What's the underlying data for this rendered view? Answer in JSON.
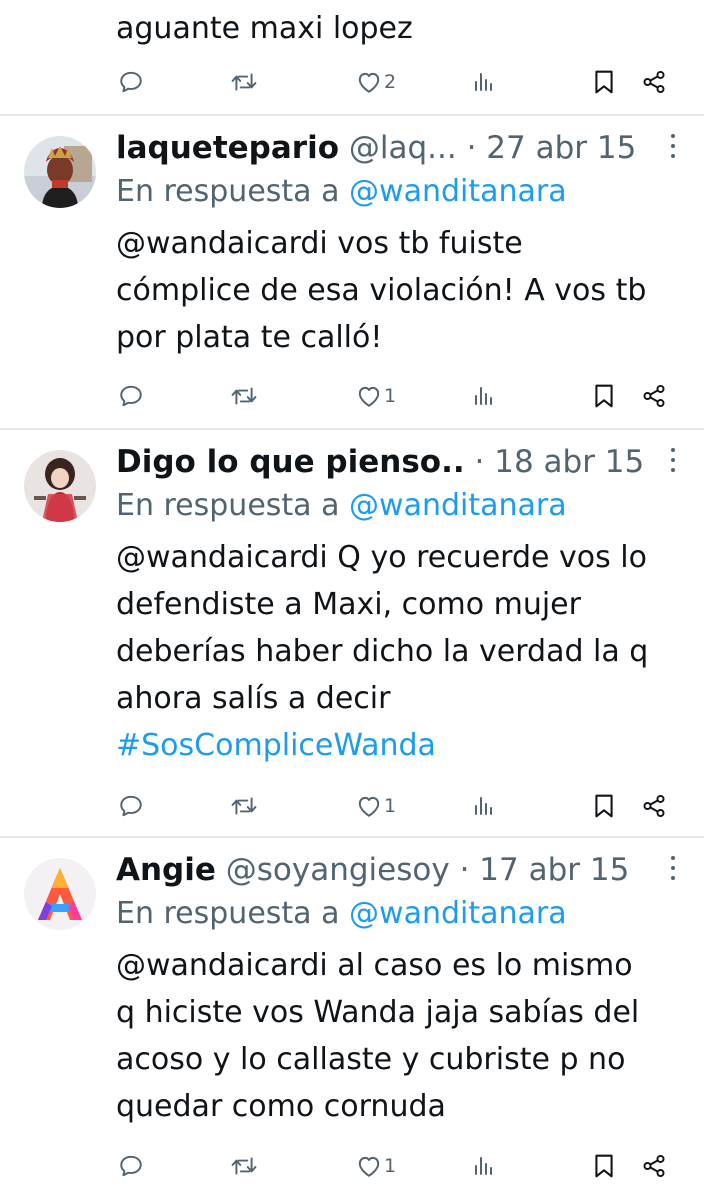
{
  "tweets": [
    {
      "body_lines": [
        "aguante maxi lopez"
      ],
      "actions": {
        "likes": "2"
      }
    },
    {
      "name": "laquetepario",
      "handle": "@laq...",
      "time": "· 27 abr 15",
      "reply_prefix": "En respuesta a",
      "reply_to": "@wanditanara",
      "body_lines": [
        "@wandaicardi vos tb fuiste",
        "cómplice de esa violación! A vos tb",
        "por plata te calló!"
      ],
      "actions": {
        "likes": "1"
      }
    },
    {
      "name": "Digo lo que pienso..",
      "time": "· 18 abr 15",
      "reply_prefix": "En respuesta a",
      "reply_to": "@wanditanara",
      "body_lines": [
        "@wandaicardi Q yo recuerde vos lo",
        "defendiste a Maxi, como mujer",
        "deberías haber dicho la verdad la q",
        "ahora salís a decir"
      ],
      "hashtag": "#SosCompliceWanda",
      "actions": {
        "likes": "1"
      }
    },
    {
      "name": "Angie",
      "handle": "@soyangiesoy",
      "time": "· 17 abr 15",
      "reply_prefix": "En respuesta a",
      "reply_to": "@wanditanara",
      "body_lines": [
        "@wandaicardi al caso es lo mismo",
        "q hiciste vos Wanda jaja sabías del",
        "acoso y lo callaste y cubriste p no",
        "quedar como cornuda"
      ],
      "actions": {
        "likes": "1"
      }
    }
  ],
  "icons": [
    "reply-icon",
    "retweet-icon",
    "like-icon",
    "views-icon",
    "bookmark-icon",
    "share-icon",
    "more-icon"
  ],
  "colors": {
    "link": "#1d9bf0",
    "muted": "#536471",
    "text": "#0f1419",
    "divider": "#e6e9ec"
  }
}
